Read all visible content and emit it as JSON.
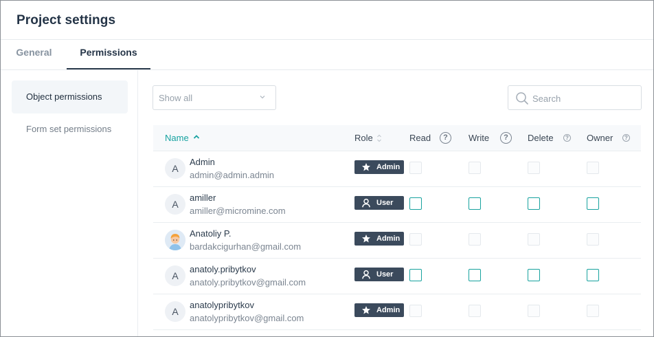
{
  "header": {
    "title": "Project settings"
  },
  "tabs": [
    {
      "label": "General",
      "active": false
    },
    {
      "label": "Permissions",
      "active": true
    }
  ],
  "sidebar": {
    "items": [
      {
        "label": "Object permissions",
        "active": true
      },
      {
        "label": "Form set permissions",
        "active": false
      }
    ]
  },
  "filter": {
    "value": "Show all"
  },
  "search": {
    "placeholder": "Search",
    "value": ""
  },
  "table": {
    "columns": {
      "name": "Name",
      "role": "Role",
      "read": "Read",
      "write": "Write",
      "delete": "Delete",
      "owner": "Owner"
    },
    "sort": {
      "column": "Name",
      "direction": "ascending"
    },
    "help_glyph": "?",
    "rows": [
      {
        "avatar": "A",
        "name": "Admin",
        "email": "admin@admin.admin",
        "role": "Admin",
        "role_icon": "star-icon",
        "checkboxes_enabled": false,
        "read": false,
        "write": false,
        "delete": false,
        "owner": false
      },
      {
        "avatar": "A",
        "name": "amiller",
        "email": "amiller@micromine.com",
        "role": "User",
        "role_icon": "user-icon",
        "checkboxes_enabled": true,
        "read": false,
        "write": false,
        "delete": false,
        "owner": false
      },
      {
        "avatar": "",
        "avatar_icon": "user-photo-avatar",
        "name": "Anatoliy P.",
        "email": "bardakcigurhan@gmail.com",
        "role": "Admin",
        "role_icon": "star-icon",
        "checkboxes_enabled": false,
        "read": false,
        "write": false,
        "delete": false,
        "owner": false
      },
      {
        "avatar": "A",
        "name": "anatoly.pribytkov",
        "email": "anatoly.pribytkov@gmail.com",
        "role": "User",
        "role_icon": "user-icon",
        "checkboxes_enabled": true,
        "read": false,
        "write": false,
        "delete": false,
        "owner": false
      },
      {
        "avatar": "A",
        "name": "anatolypribytkov",
        "email": "anatolypribytkov@gmail.com",
        "role": "Admin",
        "role_icon": "star-icon",
        "checkboxes_enabled": false,
        "read": false,
        "write": false,
        "delete": false,
        "owner": false
      }
    ]
  },
  "colors": {
    "accent_teal": "#16a2a0",
    "badge_background": "#3b4a5c",
    "title_text": "#243447",
    "muted_text": "#7b8591"
  }
}
